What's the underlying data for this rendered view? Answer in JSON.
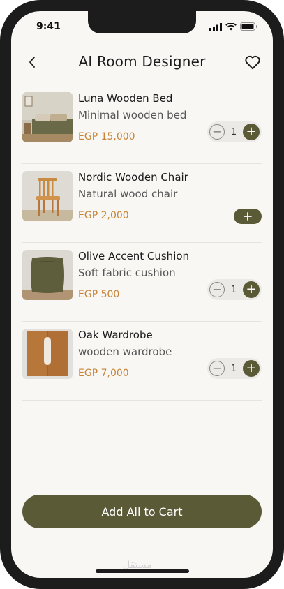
{
  "status_bar": {
    "time": "9:41"
  },
  "header": {
    "title": "AI Room Designer"
  },
  "items": [
    {
      "name": "Luna Wooden Bed",
      "description": "Minimal wooden bed",
      "price": "EGP 15,000",
      "quantity": "1"
    },
    {
      "name": "Nordic Wooden Chair",
      "description": "Natural wood chair",
      "price": "EGP 2,000"
    },
    {
      "name": "Olive Accent Cushion",
      "description": "Soft fabric cushion",
      "price": "EGP 500",
      "quantity": "1"
    },
    {
      "name": "Oak Wardrobe",
      "description": "wooden wardrobe",
      "price": "EGP 7,000",
      "quantity": "1"
    }
  ],
  "cta": {
    "label": "Add All to Cart"
  },
  "watermark": "مستقل",
  "colors": {
    "accent": "#5b5a37",
    "price": "#c68336",
    "background": "#f8f7f4"
  }
}
